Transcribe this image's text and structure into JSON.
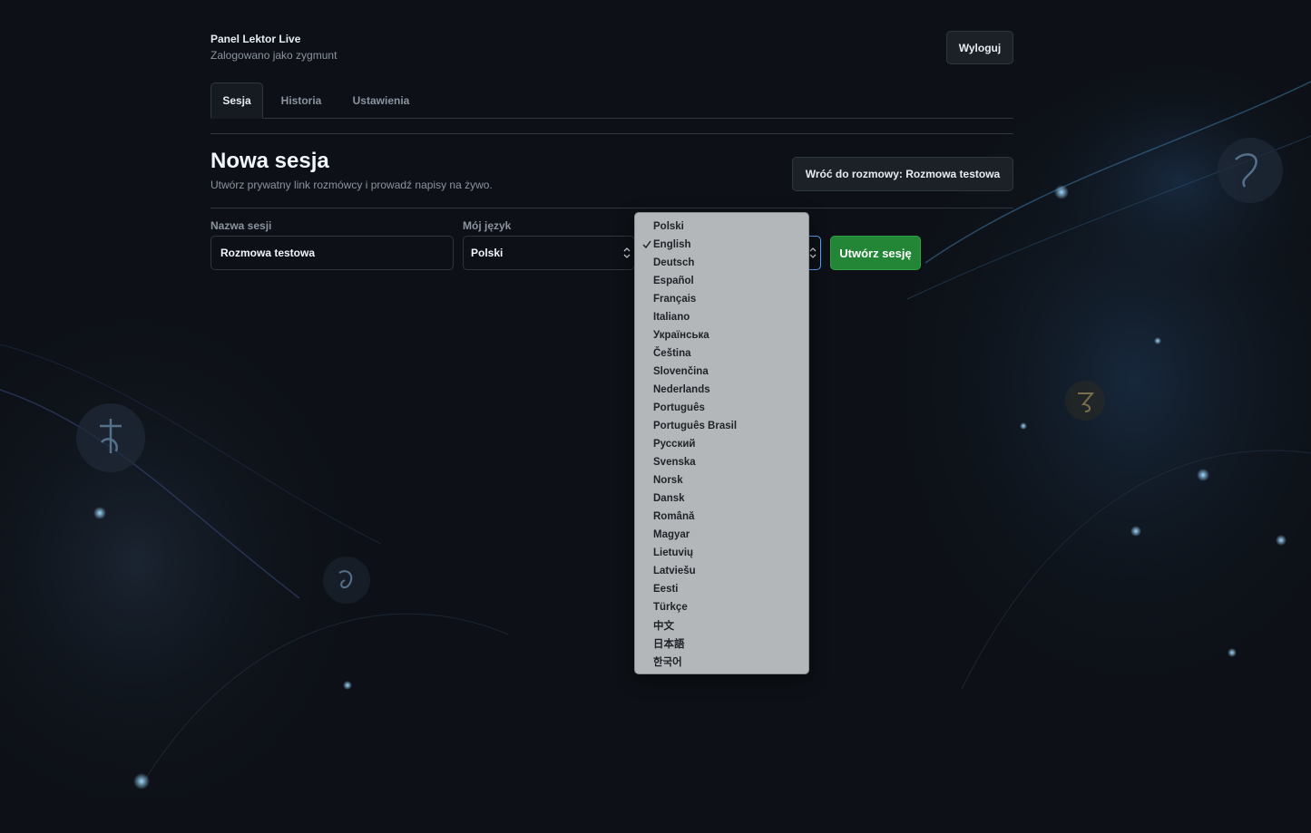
{
  "header": {
    "title": "Panel Lektor Live",
    "subtitle": "Zalogowano jako zygmunt",
    "logout_label": "Wyloguj"
  },
  "tabs": [
    {
      "label": "Sesja",
      "active": true
    },
    {
      "label": "Historia",
      "active": false
    },
    {
      "label": "Ustawienia",
      "active": false
    }
  ],
  "page": {
    "title": "Nowa sesja",
    "description": "Utwórz prywatny link rozmówcy i prowadź napisy na żywo.",
    "back_label": "Wróć do rozmowy: Rozmowa testowa"
  },
  "form": {
    "name_label": "Nazwa sesji",
    "name_value": "Rozmowa testowa",
    "my_lang_label": "Mój język",
    "my_lang_value": "Polski",
    "create_label": "Utwórz sesję"
  },
  "dropdown": {
    "selected": "English",
    "options": [
      "Polski",
      "English",
      "Deutsch",
      "Español",
      "Français",
      "Italiano",
      "Українська",
      "Čeština",
      "Slovenčina",
      "Nederlands",
      "Português",
      "Português Brasil",
      "Русский",
      "Svenska",
      "Norsk",
      "Dansk",
      "Română",
      "Magyar",
      "Lietuvių",
      "Latviešu",
      "Eesti",
      "Türkçe",
      "中文",
      "日本語",
      "한국어"
    ]
  },
  "colors": {
    "background": "#0d1117",
    "accent_green": "#238636",
    "focus_blue": "#58a6ff",
    "dropdown_bg": "#b3b7ba"
  }
}
